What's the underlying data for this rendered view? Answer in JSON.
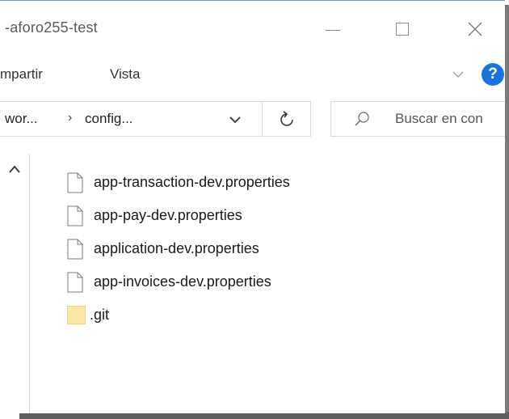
{
  "window": {
    "title": "-aforo255-test",
    "minimize_icon": "minimize-icon",
    "maximize_icon": "maximize-icon",
    "close_icon": "close-icon",
    "close_glyph": "✕"
  },
  "ribbon": {
    "tabs": [
      {
        "label": "mpartir"
      },
      {
        "label": "Vista"
      }
    ],
    "expand_icon": "chevron-down-icon",
    "help_glyph": "?",
    "help_color": "#1a73d9"
  },
  "address": {
    "crumbs": [
      {
        "label": "wor..."
      },
      {
        "label": "config..."
      }
    ],
    "separator": "›",
    "dropdown_icon": "chevron-down-icon",
    "refresh_icon": "refresh-icon"
  },
  "search": {
    "placeholder": "Buscar en con",
    "icon": "search-icon"
  },
  "files": [
    {
      "name": "app-transaction-dev.properties",
      "type": "file"
    },
    {
      "name": "app-pay-dev.properties",
      "type": "file"
    },
    {
      "name": "application-dev.properties",
      "type": "file"
    },
    {
      "name": "app-invoices-dev.properties",
      "type": "file"
    },
    {
      "name": ".git",
      "type": "folder"
    }
  ],
  "colors": {
    "accent": "#1a73d9",
    "folder": "#fde8a8",
    "window_border": "#6b95c8"
  }
}
